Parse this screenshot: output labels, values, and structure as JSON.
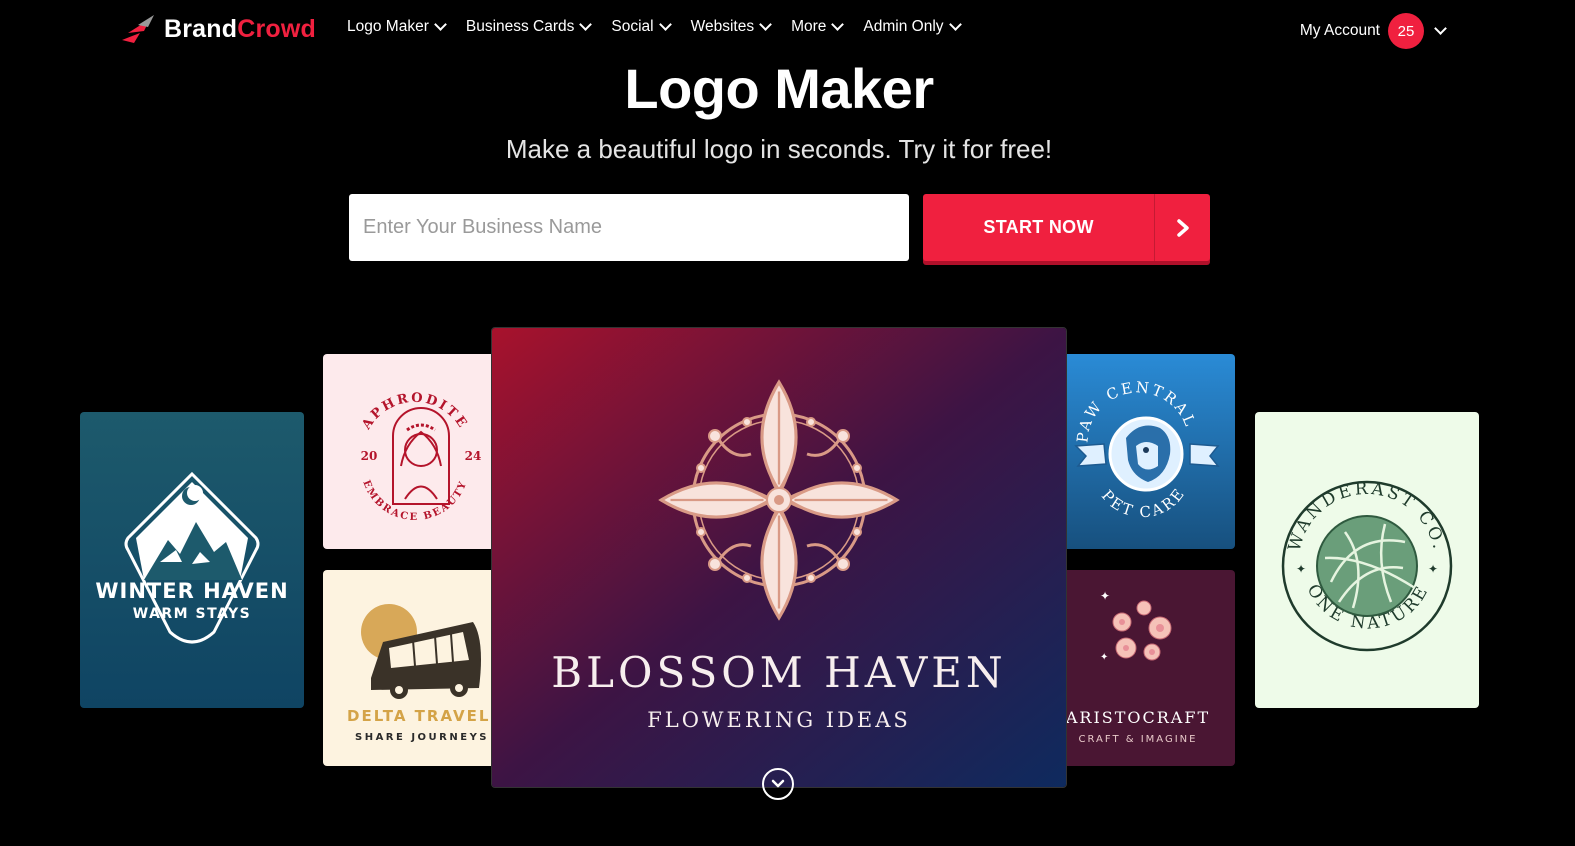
{
  "nav": {
    "brand_part1": "Brand",
    "brand_part2": "Crowd",
    "items": [
      {
        "label": "Logo Maker"
      },
      {
        "label": "Business Cards"
      },
      {
        "label": "Social"
      },
      {
        "label": "Websites"
      },
      {
        "label": "More"
      },
      {
        "label": "Admin Only"
      }
    ],
    "account_label": "My Account",
    "notification_count": "25"
  },
  "hero": {
    "title": "Logo Maker",
    "subtitle": "Make a beautiful logo in seconds. Try it for free!",
    "input_placeholder": "Enter Your Business Name",
    "cta_label": "START NOW"
  },
  "logos": {
    "winter": {
      "line1": "WINTER HAVEN",
      "line2": "WARM STAYS"
    },
    "aphrodite": {
      "top": "APHRODITE",
      "left_num": "20",
      "right_num": "24",
      "bottom": "EMBRACE BEAUTY"
    },
    "delta": {
      "line1": "DELTA TRAVELS",
      "line2": "SHARE JOURNEYS"
    },
    "blossom": {
      "line1": "BLOSSOM HAVEN",
      "line2": "FLOWERING IDEAS"
    },
    "paw": {
      "top": "PAW CENTRAL",
      "bottom": "PET CARE"
    },
    "aristocraft": {
      "line1": "ARISTOCRAFT",
      "line2": "CRAFT & IMAGINE"
    },
    "wanderast": {
      "top": "WANDERAST CO.",
      "bottom": "ONE NATURE"
    }
  },
  "colors": {
    "accent": "#f0203f",
    "background": "#000000"
  }
}
